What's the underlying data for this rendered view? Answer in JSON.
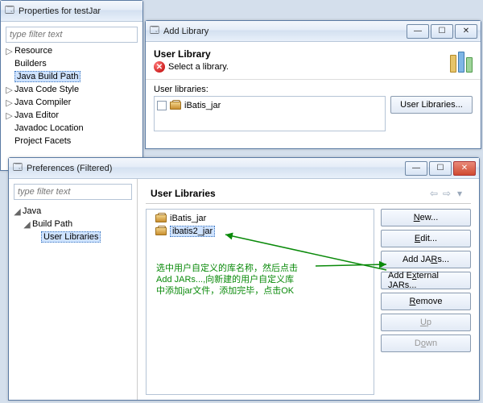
{
  "win_props": {
    "title": "Properties for testJar",
    "filter_placeholder": "type filter text",
    "tree": {
      "resource": "Resource",
      "builders": "Builders",
      "javabuild": "Java Build Path",
      "codestyle": "Java Code Style",
      "compiler": "Java Compiler",
      "editor": "Java Editor",
      "javadoc": "Javadoc Location",
      "facets": "Project Facets"
    }
  },
  "win_addlib": {
    "title": "Add Library",
    "heading": "User Library",
    "error": "Select a library.",
    "list_label": "User libraries:",
    "items": {
      "ibatis": "iBatis_jar"
    },
    "btn_userlib": "User Libraries..."
  },
  "win_prefs": {
    "title": "Preferences (Filtered)",
    "filter_placeholder": "type filter text",
    "tree": {
      "java": "Java",
      "buildpath": "Build Path",
      "userlib": "User Libraries"
    },
    "heading": "User Libraries",
    "items": {
      "ibatis": "iBatis_jar",
      "ibatis2": "ibatis2_jar"
    },
    "buttons": {
      "new": "New...",
      "edit": "Edit...",
      "addjars": "Add JARs...",
      "addext": "Add External JARs...",
      "remove": "Remove",
      "up": "Up",
      "down": "Down"
    },
    "annotation": "选中用户自定义的库名称，然后点击\nAdd JARs...,向新建的用户自定义库\n中添加jar文件，添加完毕，点击OK"
  }
}
